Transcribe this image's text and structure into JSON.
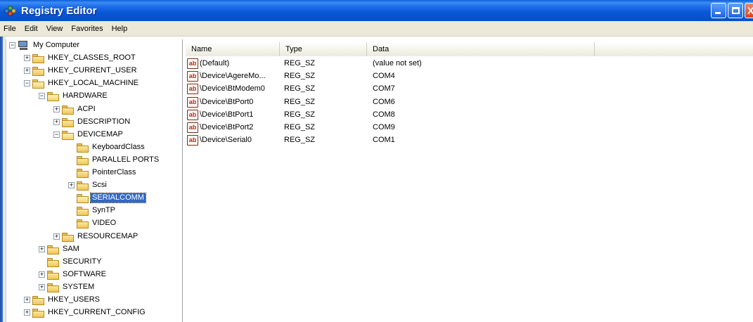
{
  "window": {
    "title": "Registry Editor",
    "controls": {
      "minimize": "",
      "maximize": "",
      "close": "X"
    }
  },
  "menu": [
    "File",
    "Edit",
    "View",
    "Favorites",
    "Help"
  ],
  "tree": [
    {
      "label": "My Computer",
      "depth": 0,
      "expander": "−",
      "icon": "computer-icon"
    },
    {
      "label": "HKEY_CLASSES_ROOT",
      "depth": 1,
      "expander": "+",
      "icon": "folder-icon"
    },
    {
      "label": "HKEY_CURRENT_USER",
      "depth": 1,
      "expander": "+",
      "icon": "folder-icon"
    },
    {
      "label": "HKEY_LOCAL_MACHINE",
      "depth": 1,
      "expander": "−",
      "icon": "folder-open-icon"
    },
    {
      "label": "HARDWARE",
      "depth": 2,
      "expander": "−",
      "icon": "folder-open-icon"
    },
    {
      "label": "ACPI",
      "depth": 3,
      "expander": "+",
      "icon": "folder-icon"
    },
    {
      "label": "DESCRIPTION",
      "depth": 3,
      "expander": "+",
      "icon": "folder-icon"
    },
    {
      "label": "DEVICEMAP",
      "depth": 3,
      "expander": "−",
      "icon": "folder-open-icon"
    },
    {
      "label": "KeyboardClass",
      "depth": 4,
      "expander": "",
      "icon": "folder-icon"
    },
    {
      "label": "PARALLEL PORTS",
      "depth": 4,
      "expander": "",
      "icon": "folder-icon"
    },
    {
      "label": "PointerClass",
      "depth": 4,
      "expander": "",
      "icon": "folder-icon"
    },
    {
      "label": "Scsi",
      "depth": 4,
      "expander": "+",
      "icon": "folder-icon"
    },
    {
      "label": "SERIALCOMM",
      "depth": 4,
      "expander": "",
      "icon": "folder-open-icon",
      "selected": true
    },
    {
      "label": "SynTP",
      "depth": 4,
      "expander": "",
      "icon": "folder-icon"
    },
    {
      "label": "VIDEO",
      "depth": 4,
      "expander": "",
      "icon": "folder-icon"
    },
    {
      "label": "RESOURCEMAP",
      "depth": 3,
      "expander": "+",
      "icon": "folder-icon"
    },
    {
      "label": "SAM",
      "depth": 2,
      "expander": "+",
      "icon": "folder-icon"
    },
    {
      "label": "SECURITY",
      "depth": 2,
      "expander": "",
      "icon": "folder-icon"
    },
    {
      "label": "SOFTWARE",
      "depth": 2,
      "expander": "+",
      "icon": "folder-icon"
    },
    {
      "label": "SYSTEM",
      "depth": 2,
      "expander": "+",
      "icon": "folder-icon"
    },
    {
      "label": "HKEY_USERS",
      "depth": 1,
      "expander": "+",
      "icon": "folder-icon"
    },
    {
      "label": "HKEY_CURRENT_CONFIG",
      "depth": 1,
      "expander": "+",
      "icon": "folder-icon"
    }
  ],
  "list": {
    "columns": [
      "Name",
      "Type",
      "Data"
    ],
    "rows": [
      {
        "name": "(Default)",
        "type": "REG_SZ",
        "data": "(value not set)",
        "icon": "ab"
      },
      {
        "name": "\\Device\\AgereMo...",
        "type": "REG_SZ",
        "data": "COM4",
        "icon": "ab"
      },
      {
        "name": "\\Device\\BtModem0",
        "type": "REG_SZ",
        "data": "COM7",
        "icon": "ab"
      },
      {
        "name": "\\Device\\BtPort0",
        "type": "REG_SZ",
        "data": "COM6",
        "icon": "ab"
      },
      {
        "name": "\\Device\\BtPort1",
        "type": "REG_SZ",
        "data": "COM8",
        "icon": "ab"
      },
      {
        "name": "\\Device\\BtPort2",
        "type": "REG_SZ",
        "data": "COM9",
        "icon": "ab"
      },
      {
        "name": "\\Device\\Serial0",
        "type": "REG_SZ",
        "data": "COM1",
        "icon": "ab"
      }
    ]
  },
  "colors": {
    "titlebar": "#0757d6",
    "selection": "#316ac5",
    "menubar": "#ece9d8"
  }
}
